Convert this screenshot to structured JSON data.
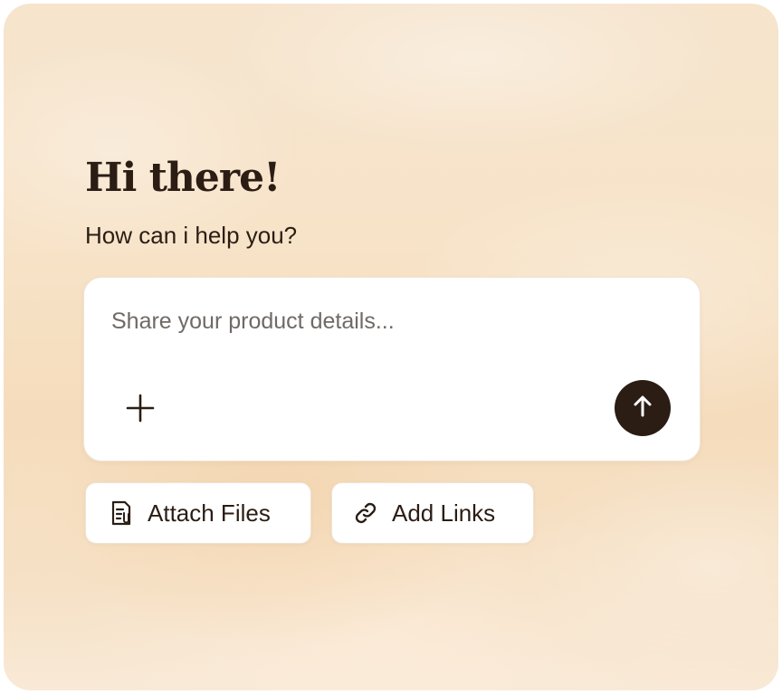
{
  "greeting": {
    "title": "Hi there!",
    "subtitle": "How can i help you?"
  },
  "composer": {
    "value": "",
    "placeholder": "Share your product details...",
    "add_icon": "plus-icon",
    "send_icon": "arrow-up-icon"
  },
  "actions": [
    {
      "label": "Attach Files",
      "icon": "document-icon"
    },
    {
      "label": "Add Links",
      "icon": "link-icon"
    }
  ],
  "colors": {
    "text": "#2b1d14",
    "send_button": "#2b1d14",
    "background": "#f6e1c6",
    "surface": "#ffffff"
  }
}
